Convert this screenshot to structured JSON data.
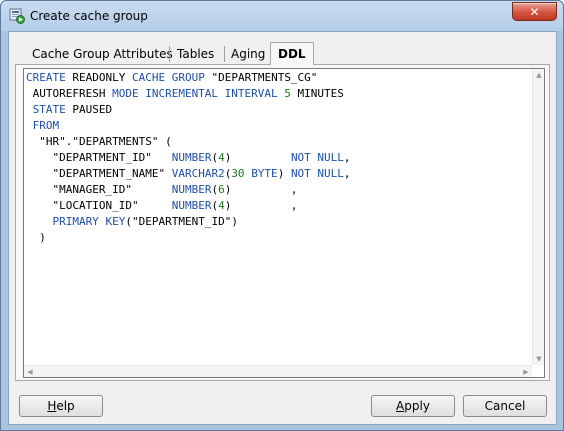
{
  "window": {
    "title": "Create cache group",
    "close_glyph": "✕"
  },
  "icons": {
    "app_icon": "cache-group-window-icon",
    "close_icon": "close-icon"
  },
  "tabs": [
    {
      "label": "Cache Group Attributes",
      "active": false
    },
    {
      "label": "Tables",
      "active": false
    },
    {
      "label": "Aging",
      "active": false
    },
    {
      "label": "DDL",
      "active": true
    }
  ],
  "ddl": {
    "lines": [
      [
        {
          "t": "CREATE",
          "c": "kw"
        },
        {
          "t": " READONLY ",
          "c": ""
        },
        {
          "t": "CACHE GROUP",
          "c": "kw"
        },
        {
          "t": " \"DEPARTMENTS_CG\"",
          "c": ""
        }
      ],
      [
        {
          "t": " AUTOREFRESH ",
          "c": ""
        },
        {
          "t": "MODE INCREMENTAL INTERVAL",
          "c": "kw"
        },
        {
          "t": " ",
          "c": ""
        },
        {
          "t": "5",
          "c": "num"
        },
        {
          "t": " MINUTES",
          "c": ""
        }
      ],
      [
        {
          "t": " ",
          "c": ""
        },
        {
          "t": "STATE",
          "c": "kw"
        },
        {
          "t": " PAUSED",
          "c": ""
        }
      ],
      [
        {
          "t": " ",
          "c": ""
        },
        {
          "t": "FROM",
          "c": "kw"
        }
      ],
      [
        {
          "t": "  \"HR\".\"DEPARTMENTS\" (",
          "c": ""
        }
      ],
      [
        {
          "t": "    \"DEPARTMENT_ID\"   ",
          "c": ""
        },
        {
          "t": "NUMBER",
          "c": "kw"
        },
        {
          "t": "(",
          "c": ""
        },
        {
          "t": "4",
          "c": "num"
        },
        {
          "t": ")         ",
          "c": ""
        },
        {
          "t": "NOT NULL",
          "c": "kw"
        },
        {
          "t": ",",
          "c": ""
        }
      ],
      [
        {
          "t": "    \"DEPARTMENT_NAME\" ",
          "c": ""
        },
        {
          "t": "VARCHAR2",
          "c": "kw"
        },
        {
          "t": "(",
          "c": ""
        },
        {
          "t": "30",
          "c": "num"
        },
        {
          "t": " ",
          "c": ""
        },
        {
          "t": "BYTE",
          "c": "kw"
        },
        {
          "t": ") ",
          "c": ""
        },
        {
          "t": "NOT NULL",
          "c": "kw"
        },
        {
          "t": ",",
          "c": ""
        }
      ],
      [
        {
          "t": "    \"MANAGER_ID\"      ",
          "c": ""
        },
        {
          "t": "NUMBER",
          "c": "kw"
        },
        {
          "t": "(",
          "c": ""
        },
        {
          "t": "6",
          "c": "num"
        },
        {
          "t": ")         ,",
          "c": ""
        }
      ],
      [
        {
          "t": "    \"LOCATION_ID\"     ",
          "c": ""
        },
        {
          "t": "NUMBER",
          "c": "kw"
        },
        {
          "t": "(",
          "c": ""
        },
        {
          "t": "4",
          "c": "num"
        },
        {
          "t": ")         ,",
          "c": ""
        }
      ],
      [
        {
          "t": "    ",
          "c": ""
        },
        {
          "t": "PRIMARY KEY",
          "c": "kw"
        },
        {
          "t": "(\"DEPARTMENT_ID\")",
          "c": ""
        }
      ],
      [
        {
          "t": "  )",
          "c": ""
        }
      ]
    ]
  },
  "buttons": {
    "help": {
      "label": "Help",
      "mnemonic": "H"
    },
    "apply": {
      "label": "Apply",
      "mnemonic": "A"
    },
    "cancel": {
      "label": "Cancel"
    }
  },
  "colors": {
    "keyword": "#1f4fa3",
    "number": "#1f7a1f",
    "title_bar": "#b4cde8",
    "close_button": "#d2543f"
  }
}
